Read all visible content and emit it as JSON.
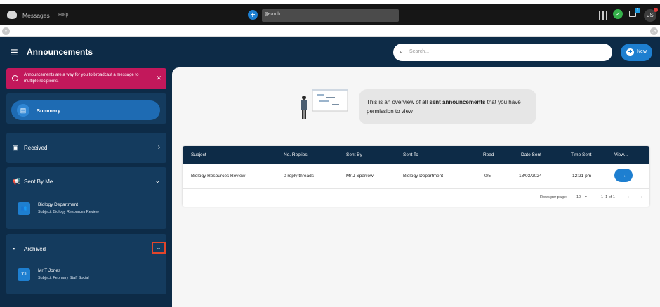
{
  "topbar": {
    "app_name": "Messages",
    "help": "Help",
    "search_placeholder": "Search",
    "msg_badge": "1",
    "avatar_initials": "JS"
  },
  "header": {
    "title": "Announcements",
    "search_placeholder": "Search...",
    "new_label": "New"
  },
  "alert": {
    "text": "Announcements are a way for you to broadcast a message to multiple recipients."
  },
  "sidebar": {
    "summary_label": "Summary",
    "received_label": "Received",
    "sent_by_me_label": "Sent By Me",
    "sent_item": {
      "icon_text": "",
      "title": "Biology Department",
      "subtitle": "Subject: Biology Resources Review"
    },
    "archived_label": "Archived",
    "archived_item": {
      "initials": "TJ",
      "title": "Mr T Jones",
      "subtitle": "Subject: February Staff Social"
    }
  },
  "overview": {
    "prefix": "This is an overview of all ",
    "bold": "sent announcements",
    "suffix": " that you have permission to view"
  },
  "table": {
    "headers": [
      "Subject",
      "No. Replies",
      "Sent By",
      "Sent To",
      "Read",
      "Date Sent",
      "Time Sent",
      "View..."
    ],
    "rows": [
      {
        "subject": "Biology Resources Review",
        "replies": "0 reply threads",
        "sent_by": "Mr J Sparrow",
        "sent_to": "Biology Department",
        "read": "0/5",
        "date": "18/03/2024",
        "time": "12:21 pm"
      }
    ],
    "rows_per_page_label": "Rows per page:",
    "rows_per_page": "10",
    "range": "1–1 of 1"
  },
  "colors": {
    "navy": "#0d2b47",
    "accent": "#1e7fd0",
    "alert": "#c2185b",
    "highlight": "#e2452b"
  }
}
